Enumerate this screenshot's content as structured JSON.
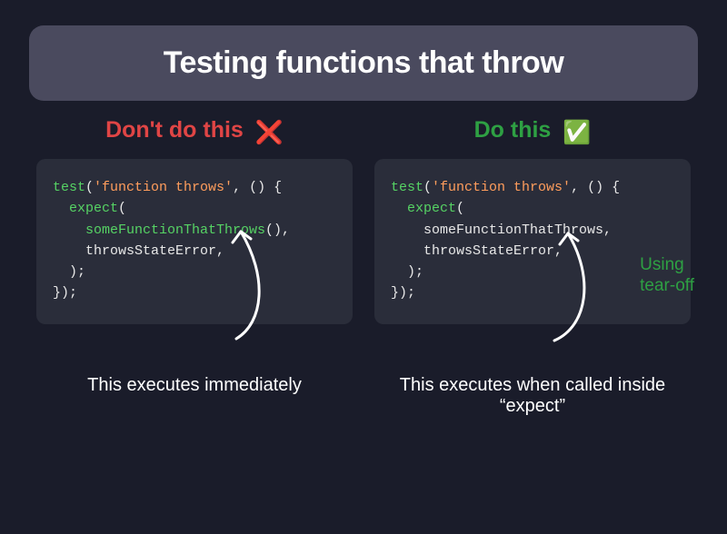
{
  "header": {
    "title": "Testing functions that throw"
  },
  "left": {
    "title": "Don't do this",
    "emoji": "❌",
    "code": {
      "l1a": "test",
      "l1b": "(",
      "l1c": "'function throws'",
      "l1d": ", () {",
      "l2a": "  expect",
      "l2b": "(",
      "l3a": "    someFunctionThatThrows",
      "l3b": "(),",
      "l4": "    throwsStateError,",
      "l5": "  );",
      "l6": "});"
    },
    "caption": "This executes immediately"
  },
  "right": {
    "title": "Do this",
    "emoji": "✅",
    "code": {
      "l1a": "test",
      "l1b": "(",
      "l1c": "'function throws'",
      "l1d": ", () {",
      "l2a": "  expect",
      "l2b": "(",
      "l3": "    someFunctionThatThrows,",
      "l4": "    throwsStateError,",
      "l5": "  );",
      "l6": "});"
    },
    "annot": "Using\ntear-off",
    "caption": "This executes when called inside “expect”"
  }
}
